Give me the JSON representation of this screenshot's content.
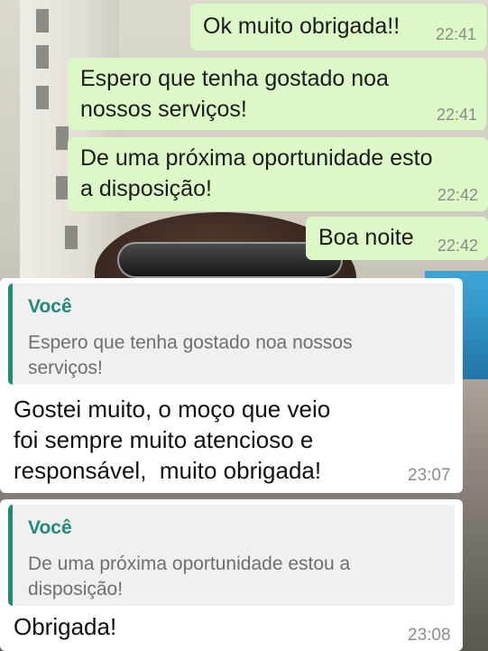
{
  "colors": {
    "outgoing_bubble": "#dcf8c6",
    "incoming_bubble": "#ffffff",
    "quote_bar": "#1f8a78",
    "timestamp": "#8c8c8c"
  },
  "messages_out": [
    {
      "text": "Ok muito obrigada!!",
      "time": "22:41"
    },
    {
      "text": "Espero que tenha gostado noa\nnossos serviços!",
      "time": "22:41"
    },
    {
      "text": "De uma próxima oportunidade esto\na disposição!",
      "time": "22:42"
    },
    {
      "text": "Boa noite",
      "time": "22:42"
    }
  ],
  "messages_in": [
    {
      "quote_author": "Você",
      "quote_text": "Espero que tenha gostado noa nossos\nserviços!",
      "text": "Gostei muito, o moço que veio\nfoi sempre muito atencioso e\nresponsável,  muito obrigada!",
      "time": "23:07"
    },
    {
      "quote_author": "Você",
      "quote_text": "De uma próxima oportunidade estou a\ndisposição!",
      "text": "Obrigada!",
      "time": "23:08"
    }
  ]
}
